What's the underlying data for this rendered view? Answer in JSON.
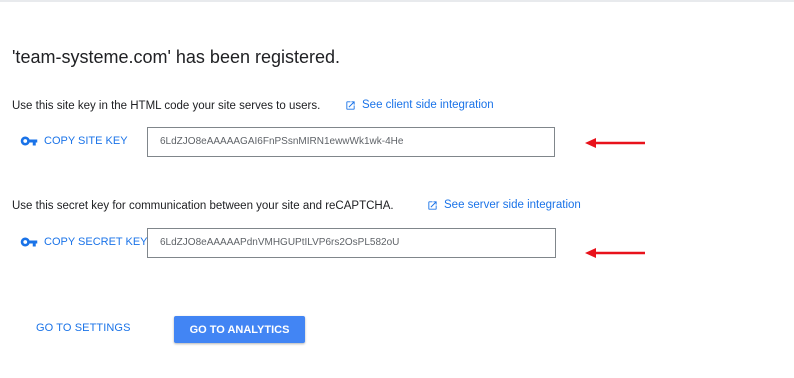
{
  "title": "'team-systeme.com' has been registered.",
  "site_key_section": {
    "description": "Use this site key in the HTML code your site serves to users.",
    "link_label": "See client side integration",
    "copy_label": "COPY SITE KEY",
    "key_value": "6LdZJO8eAAAAAGAI6FnPSsnMIRN1ewwWk1wk-4He"
  },
  "secret_key_section": {
    "description": "Use this secret key for communication between your site and reCAPTCHA.",
    "link_label": "See server side integration",
    "copy_label": "COPY SECRET KEY",
    "key_value": "6LdZJO8eAAAAAPdnVMHGUPtILVP6rs2OsPL582oU"
  },
  "actions": {
    "settings_label": "GO TO SETTINGS",
    "analytics_label": "GO TO ANALYTICS"
  },
  "icons": {
    "external_link": "open-in-new-icon",
    "key": "key-icon",
    "annotation": "red-arrow"
  },
  "colors": {
    "accent": "#1a73e8",
    "primary_button": "#4285f4",
    "annotation_arrow": "#e8121b"
  }
}
